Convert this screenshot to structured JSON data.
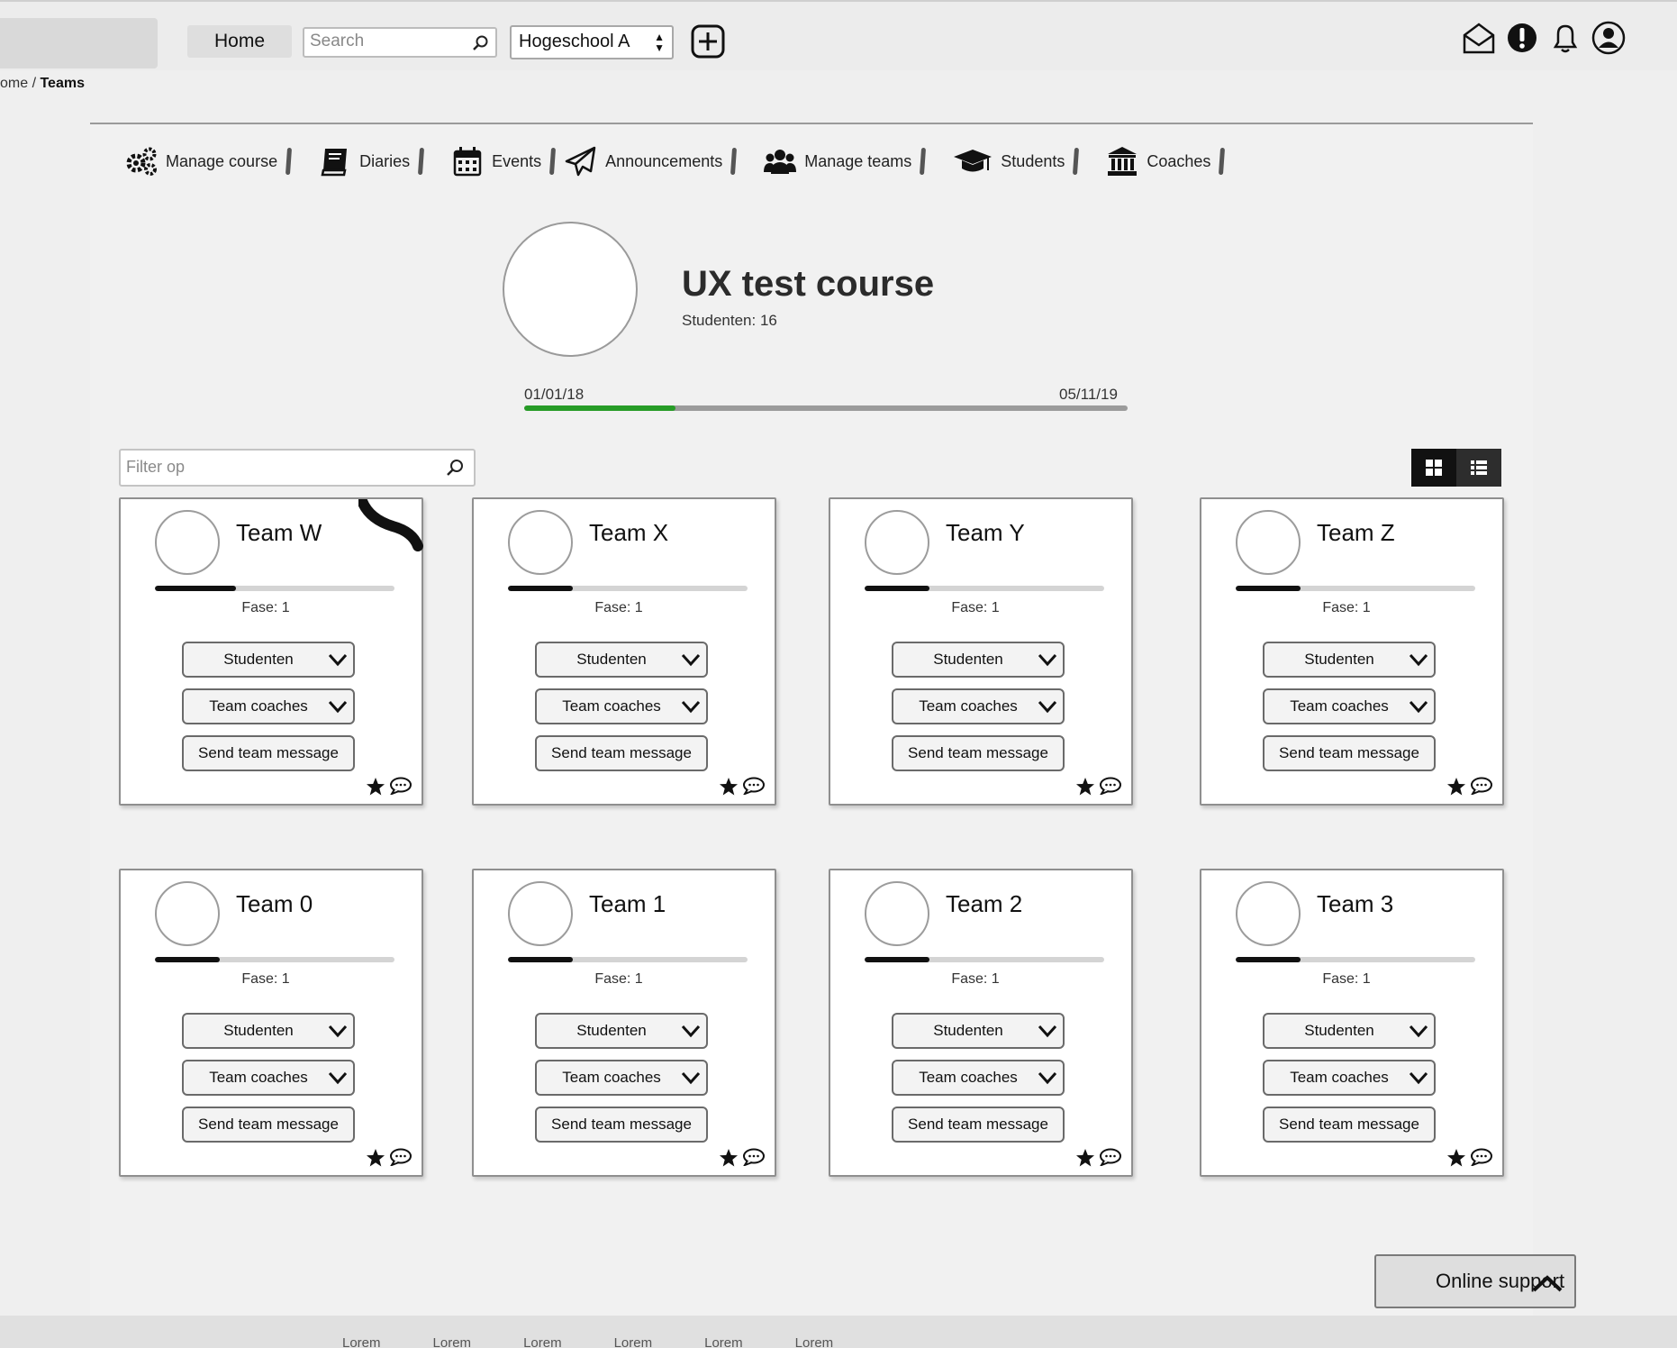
{
  "topbar": {
    "home_label": "Home",
    "search_placeholder": "Search",
    "school_selected": "Hogeschool A",
    "icons": [
      "add-icon",
      "mail-icon",
      "alert-icon",
      "bell-icon",
      "user-icon"
    ]
  },
  "breadcrumb": {
    "parent": "ome /",
    "current": "Teams"
  },
  "nav": {
    "items": [
      {
        "label": "Manage course",
        "icon": "gears-icon"
      },
      {
        "label": "Diaries",
        "icon": "book-icon"
      },
      {
        "label": "Events",
        "icon": "calendar-icon"
      },
      {
        "label": "Announcements",
        "icon": "paper-plane-icon"
      },
      {
        "label": "Manage teams",
        "icon": "users-icon"
      },
      {
        "label": "Students",
        "icon": "graduation-cap-icon"
      },
      {
        "label": "Coaches",
        "icon": "institution-icon"
      }
    ]
  },
  "course": {
    "title": "UX test course",
    "student_count": "Studenten: 16",
    "start_date": "01/01/18",
    "end_date": "05/11/19",
    "progress_fraction": 0.25,
    "progress_color": "#279c27"
  },
  "filter": {
    "placeholder": "Filter op"
  },
  "teams": [
    {
      "name": "Team W",
      "phase": "Fase: 1",
      "progress_fraction": 0.34
    },
    {
      "name": "Team X",
      "phase": "Fase: 1",
      "progress_fraction": 0.27
    },
    {
      "name": "Team Y",
      "phase": "Fase: 1",
      "progress_fraction": 0.27
    },
    {
      "name": "Team Z",
      "phase": "Fase: 1",
      "progress_fraction": 0.27
    },
    {
      "name": "Team 0",
      "phase": "Fase: 1",
      "progress_fraction": 0.27
    },
    {
      "name": "Team 1",
      "phase": "Fase: 1",
      "progress_fraction": 0.27
    },
    {
      "name": "Team 2",
      "phase": "Fase: 1",
      "progress_fraction": 0.27
    },
    {
      "name": "Team 3",
      "phase": "Fase: 1",
      "progress_fraction": 0.27
    }
  ],
  "card_buttons": {
    "students": "Studenten",
    "coaches": "Team coaches",
    "message": "Send team message"
  },
  "online_support": {
    "label": "Online support"
  },
  "footer": {
    "links": [
      "Lorem",
      "Lorem",
      "Lorem",
      "Lorem",
      "Lorem",
      "Lorem"
    ]
  }
}
